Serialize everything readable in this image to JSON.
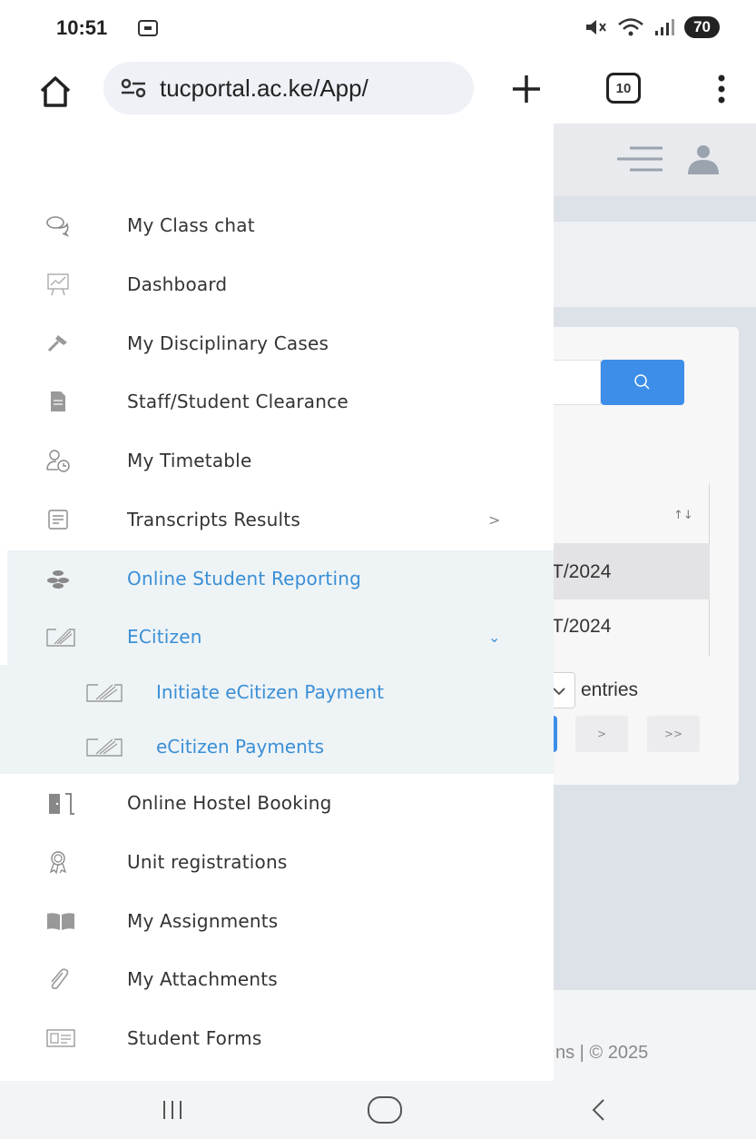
{
  "status_bar": {
    "time": "10:51",
    "battery": "70"
  },
  "browser": {
    "url": "tucportal.ac.ke/App/",
    "tab_count": "10"
  },
  "background_page": {
    "row1": "'T/2024",
    "row2": "'T/2024",
    "entries_label": "entries",
    "next_page": ">",
    "last_page": ">>",
    "footer_text": "ns | © 2025",
    "sort_indicator": "↑↓"
  },
  "drawer": {
    "items": [
      {
        "label": "My Class chat",
        "icon": "chat-bubbles-icon"
      },
      {
        "label": "Dashboard",
        "icon": "chart-board-icon"
      },
      {
        "label": "My Disciplinary Cases",
        "icon": "gavel-icon"
      },
      {
        "label": "Staff/Student Clearance",
        "icon": "document-icon"
      },
      {
        "label": "My Timetable",
        "icon": "user-clock-icon"
      },
      {
        "label": "Transcripts Results",
        "icon": "list-document-icon",
        "chevron": ">"
      },
      {
        "label": "Online Student Reporting",
        "icon": "coins-stack-icon"
      },
      {
        "label": "ECitizen",
        "icon": "signature-pad-icon",
        "chevron": "⌄"
      },
      {
        "label": "Online Hostel Booking",
        "icon": "door-icon"
      },
      {
        "label": "Unit registrations",
        "icon": "award-ribbon-icon"
      },
      {
        "label": "My Assignments",
        "icon": "open-book-icon"
      },
      {
        "label": "My Attachments",
        "icon": "paperclip-icon"
      },
      {
        "label": "Student Forms",
        "icon": "id-card-icon"
      }
    ],
    "sub_items": [
      {
        "label": "Initiate eCitizen Payment",
        "icon": "signature-pad-icon"
      },
      {
        "label": "eCitizen Payments",
        "icon": "signature-pad-icon"
      }
    ]
  },
  "colors": {
    "accent": "#3a8fd6",
    "highlight_bg": "#eef3f6",
    "search_button": "#3d8ee8"
  }
}
